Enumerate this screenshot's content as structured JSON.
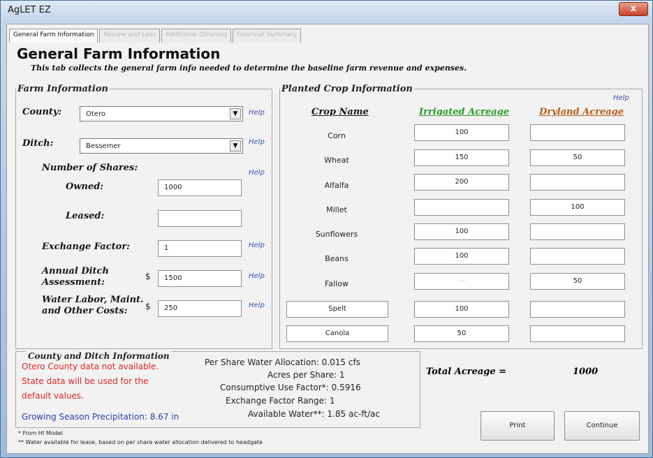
{
  "window": {
    "title": "AgLET EZ",
    "close_glyph": "x"
  },
  "tabs": [
    {
      "label": "General Farm Information",
      "active": true
    },
    {
      "label": "Review and Loss",
      "active": false
    },
    {
      "label": "Additional Gleaning",
      "active": false
    },
    {
      "label": "Financial Summary",
      "active": false
    }
  ],
  "page": {
    "title": "General Farm Information",
    "subtitle": "This tab collects the general farm info needed to determine the baseline farm revenue and expenses."
  },
  "farm": {
    "legend": "Farm Information",
    "county_label": "County:",
    "county_value": "Otero",
    "ditch_label": "Ditch:",
    "ditch_value": "Bessemer",
    "shares_label": "Number of Shares:",
    "owned_label": "Owned:",
    "owned_value": "1000",
    "leased_label": "Leased:",
    "leased_value": "",
    "exchange_label": "Exchange Factor:",
    "exchange_value": "1",
    "annual_label_1": "Annual Ditch",
    "annual_label_2": "Assessment:",
    "annual_value": "1500",
    "water_label_1": "Water Labor, Maint.",
    "water_label_2": "and Other Costs:",
    "water_value": "250",
    "dollar": "$",
    "help": "Help"
  },
  "crops": {
    "legend": "Planted Crop Information",
    "help": "Help",
    "col_name": "Crop Name",
    "col_irrigated": "Irrigated Acreage",
    "col_dryland": "Dryland Acreage",
    "irrigated_color": "#2a9a2a",
    "dryland_color": "#b85c1a",
    "rows": [
      {
        "name": "Corn",
        "irrigated": "100",
        "dryland": ""
      },
      {
        "name": "Wheat",
        "irrigated": "150",
        "dryland": "50"
      },
      {
        "name": "Alfalfa",
        "irrigated": "200",
        "dryland": ""
      },
      {
        "name": "Millet",
        "irrigated": "",
        "dryland": "100"
      },
      {
        "name": "Sunflowers",
        "irrigated": "100",
        "dryland": ""
      },
      {
        "name": "Beans",
        "irrigated": "100",
        "dryland": ""
      },
      {
        "name": "Fallow",
        "irrigated": "---",
        "dryland": "50"
      },
      {
        "name": "Spelt",
        "irrigated": "100",
        "dryland": ""
      },
      {
        "name": "Canola",
        "irrigated": "50",
        "dryland": ""
      }
    ]
  },
  "county_info": {
    "title": "County and Ditch Information",
    "warn_1": "Otero County data not available.",
    "warn_2": "State data will be used for the",
    "warn_3": "default values.",
    "precip": "Growing Season Precipitation: 8.67 in",
    "allocation": "Per Share Water Allocation: 0.015 cfs",
    "acres_per_share": "Acres per Share: 1",
    "consumptive": "Consumptive Use Factor*: 0.5916",
    "exchange_range": "Exchange Factor Range: 1",
    "available_water": "Available Water**: 1.85 ac-ft/ac"
  },
  "totals": {
    "label": "Total Acreage =",
    "value": "1000"
  },
  "buttons": {
    "print": "Print",
    "continue": "Continue"
  },
  "footnotes": {
    "note_1": "* From HI Model",
    "note_2": "** Water available for lease, based on per share water allocation delivered to headgate"
  }
}
